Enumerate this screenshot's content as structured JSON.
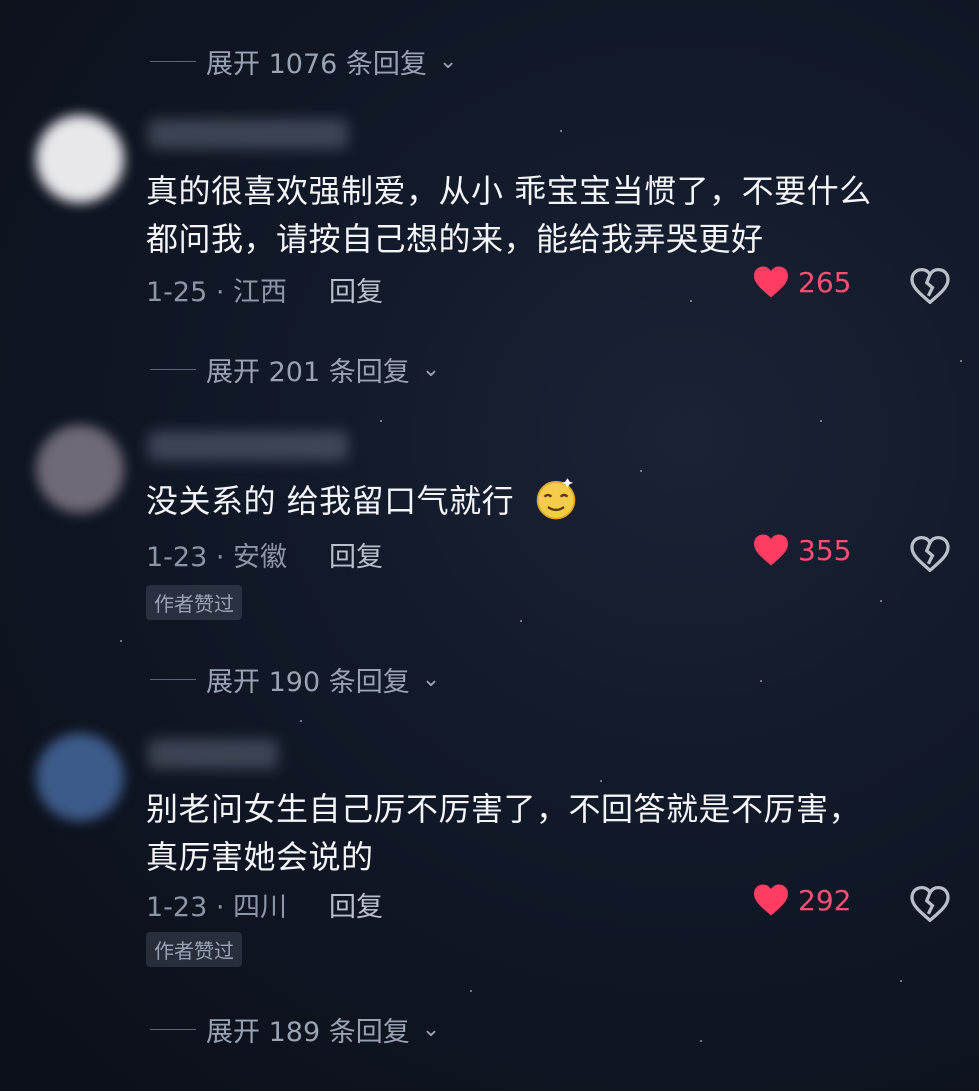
{
  "expand_rows": [
    {
      "label": "展开 1076 条回复"
    },
    {
      "label": "展开 201 条回复"
    },
    {
      "label": "展开 190 条回复"
    },
    {
      "label": "展开 189 条回复"
    }
  ],
  "comments": [
    {
      "text_line1": "真的很喜欢强制爱，从小 乖宝宝当惯了，不要什么",
      "text_line2": "都问我，请按自己想的来，能给我弄哭更好",
      "date_loc": "1-25 · 江西",
      "reply": "回复",
      "likes": "265",
      "author_liked": ""
    },
    {
      "text_line1": "没关系的 给我留口气就行",
      "text_line2": "",
      "date_loc": "1-23 · 安徽",
      "reply": "回复",
      "likes": "355",
      "author_liked": "作者赞过"
    },
    {
      "text_line1": "别老问女生自己厉不厉害了，不回答就是不厉害，",
      "text_line2": "真厉害她会说的",
      "date_loc": "1-23 · 四川",
      "reply": "回复",
      "likes": "292",
      "author_liked": "作者赞过"
    }
  ],
  "icons": {
    "chevron": "chevron-down-icon",
    "like": "heart-icon",
    "dislike": "broken-heart-icon",
    "emoji": "dizzy-face-emoji-icon"
  },
  "colors": {
    "like": "#ff4f73",
    "text": "#f3f5f8",
    "muted": "#8d96a7"
  }
}
